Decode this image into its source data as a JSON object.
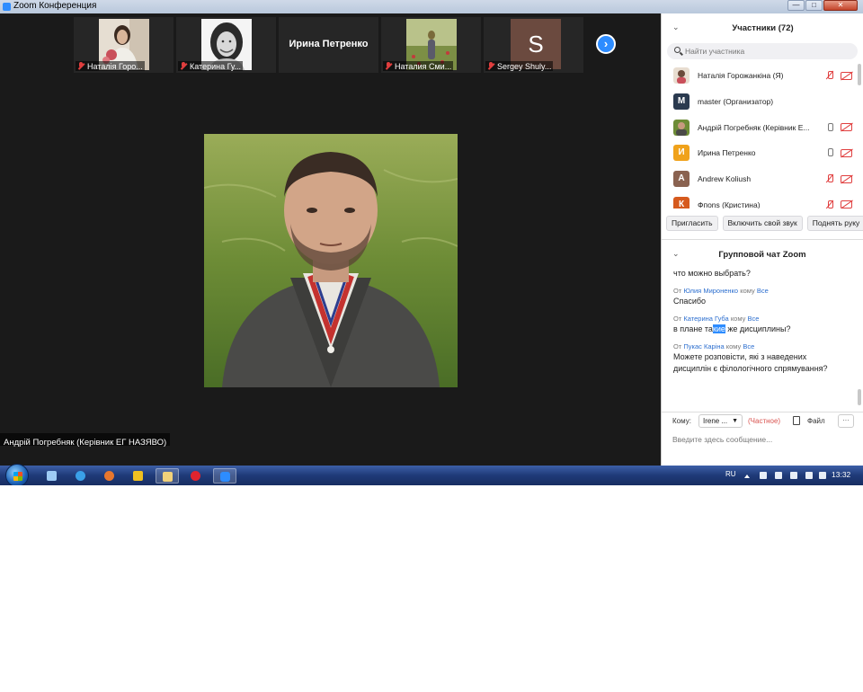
{
  "window": {
    "title": "Zoom Конференция",
    "buttons": {
      "minimize": "—",
      "maximize": "□",
      "close": "✕"
    }
  },
  "thumbnails": [
    {
      "name": "Наталія Горо...",
      "type": "photo",
      "muted": true,
      "colors": [
        "#d9c2a8",
        "#3b2a20",
        "#c94f5a"
      ]
    },
    {
      "name": "Катерина Гу...",
      "type": "photo",
      "muted": true,
      "colors": [
        "#f2f2f2",
        "#2b2b2b",
        "#bdbdbd"
      ]
    },
    {
      "name": "Ирина Петренко",
      "type": "name-only",
      "muted": false
    },
    {
      "name": "Наталия Сми...",
      "type": "photo",
      "muted": true,
      "colors": [
        "#b9c28a",
        "#7a6a3a",
        "#c23b3b"
      ]
    },
    {
      "name": "Sergey Shuly...",
      "type": "initial",
      "initial": "S",
      "muted": true,
      "colors": [
        "#6b4a3f"
      ]
    }
  ],
  "active_speaker": {
    "name": "Андрій Погребняк (Керівник ЕГ НАЗЯВО)"
  },
  "participants_panel": {
    "title": "Участники (72)",
    "search_placeholder": "Найти участника",
    "participants": [
      {
        "name": "Наталія Горожанкіна (Я)",
        "avatar": "",
        "avatar_color": "#c8a58a",
        "mic": "muted",
        "video": "off"
      },
      {
        "name": "master (Организатор)",
        "avatar": "M",
        "avatar_color": "#2a3a4f",
        "mic": "none",
        "video": "none"
      },
      {
        "name": "Андрій Погребняк (Керівник Е...",
        "avatar": "",
        "avatar_color": "#6b6b5a",
        "mic": "on",
        "video": "off"
      },
      {
        "name": "Ирина Петренко",
        "avatar": "И",
        "avatar_color": "#f0a21b",
        "mic": "on",
        "video": "off"
      },
      {
        "name": "Andrew Koliush",
        "avatar": "A",
        "avatar_color": "#8a6250",
        "mic": "muted",
        "video": "off"
      },
      {
        "name": "Фпоns (Кристина)",
        "avatar": "К",
        "avatar_color": "#d65a1e",
        "mic": "muted",
        "video": "off"
      }
    ],
    "buttons": {
      "invite": "Пригласить",
      "unmute": "Включить свой звук",
      "raise_hand": "Поднять руку"
    }
  },
  "chat_panel": {
    "title": "Групповой чат Zoom",
    "messages": [
      {
        "from": "",
        "to": "",
        "text": "что можно выбрать?"
      },
      {
        "from": "Юлия Мироненко",
        "to": "Все",
        "text": "Спасибо"
      },
      {
        "from": "Катерина Губа",
        "to": "Все",
        "text_before": "в плане та",
        "text_highlight": "кие",
        "text_after": " же дисциплины?"
      },
      {
        "from": "Пукас Каріна",
        "to": "Все",
        "text": "Можете розповісти, які з наведених дисциплін є філологічного спрямування?"
      }
    ],
    "meta_from": "От",
    "meta_to": "кому",
    "compose": {
      "to_label": "Кому:",
      "to_value": "Irene ...",
      "private_label": "(Частное)",
      "file_label": "Файл",
      "more_label": "···",
      "placeholder": "Введите здесь сообщение..."
    }
  },
  "taskbar": {
    "language": "RU",
    "time": "13:32",
    "apps": [
      {
        "name": "notepad-icon",
        "color": "#9ecbf5"
      },
      {
        "name": "ie-icon",
        "color": "#3aa0e8"
      },
      {
        "name": "firefox-icon",
        "color": "#e8772e"
      },
      {
        "name": "media-player-icon",
        "color": "#f0c020"
      },
      {
        "name": "explorer-icon",
        "color": "#f2d27a"
      },
      {
        "name": "opera-icon",
        "color": "#e0242e"
      },
      {
        "name": "zoom-icon",
        "color": "#2d8cff"
      }
    ]
  },
  "colors": {
    "accent": "#2d8cff",
    "muted_red": "#e03e3e",
    "video_bg": "#1a1a1a",
    "taskbar": "#1f3a78"
  }
}
